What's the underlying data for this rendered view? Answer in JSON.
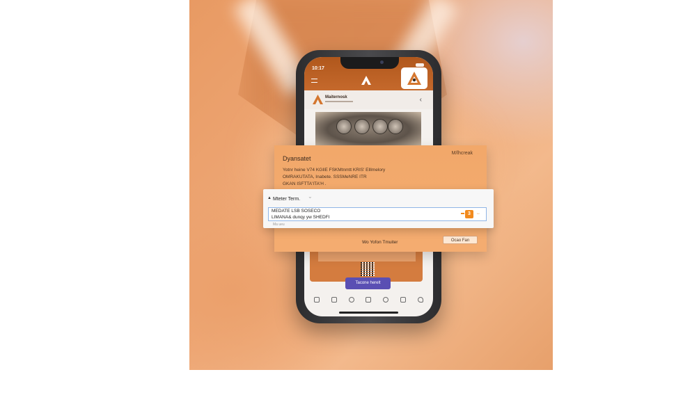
{
  "phone": {
    "status_time": "10:17",
    "brand_name": "Maiternosk",
    "cta_label": "Tacone herelt",
    "tab_icons": [
      "profile-icon",
      "wallet-icon",
      "location-icon",
      "home-icon",
      "account-icon",
      "chat-icon",
      "music-icon"
    ]
  },
  "panel": {
    "title": "Dyansatet",
    "brand": "M/lhcreak",
    "body": "Yotnr heine  V74 KGIlE FSKMtnmtt KRIS' Elllmelory\nOMRAKUTATA,  Inabete.  SSSMeNRE ITR\nGKAN  ISFTTA'ITA'H .",
    "link": "Wo Yofon Tmuiter",
    "button": "Ocao Fan"
  },
  "dialog": {
    "title": "Mteter Term.",
    "field_line1": "MEDATE LSB SOSECO",
    "field_line2": "LIMANA& dunqy yw SHEDFI",
    "badge": "3",
    "hint": "Ma ueu"
  },
  "colors": {
    "accent": "#c5692c",
    "panel": "#f4ac70",
    "cta": "#5a4fb3",
    "badge": "#f28a1d"
  }
}
